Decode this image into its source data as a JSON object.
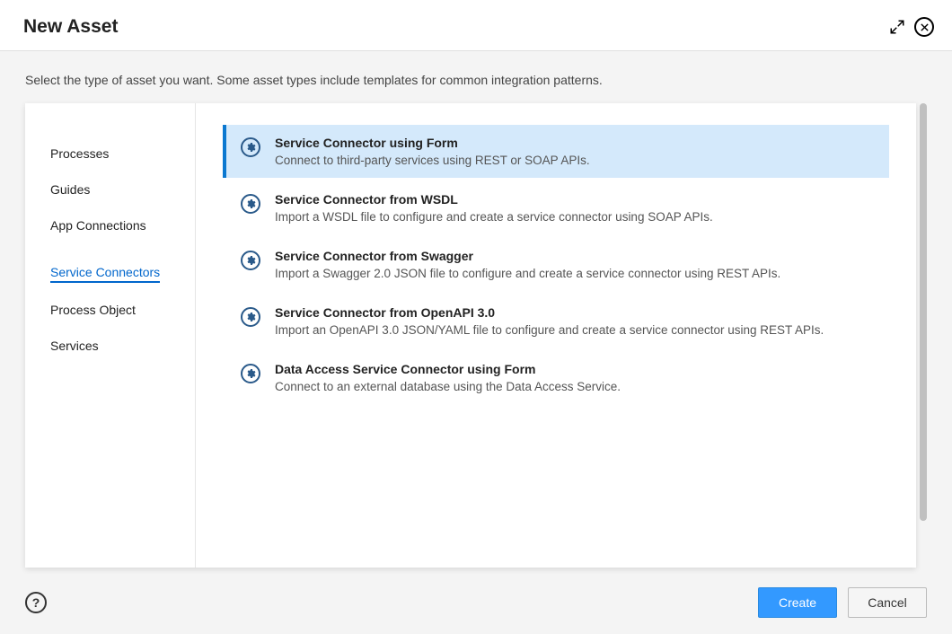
{
  "header": {
    "title": "New Asset"
  },
  "intro": "Select the type of asset you want. Some asset types include templates for common integration patterns.",
  "sidebar": {
    "items": [
      {
        "label": "Processes"
      },
      {
        "label": "Guides"
      },
      {
        "label": "App Connections"
      },
      {
        "label": "Service Connectors"
      },
      {
        "label": "Process Object"
      },
      {
        "label": "Services"
      }
    ]
  },
  "options": [
    {
      "title": "Service Connector using Form",
      "desc": "Connect to third-party services using REST or SOAP APIs."
    },
    {
      "title": "Service Connector from WSDL",
      "desc": "Import a WSDL file to configure and create a service connector using SOAP APIs."
    },
    {
      "title": "Service Connector from Swagger",
      "desc": "Import a Swagger 2.0 JSON file to configure and create a service connector using REST APIs."
    },
    {
      "title": "Service Connector from OpenAPI 3.0",
      "desc": "Import an OpenAPI 3.0 JSON/YAML file to configure and create a service connector using REST APIs."
    },
    {
      "title": "Data Access Service Connector using Form",
      "desc": "Connect to an external database using the Data Access Service."
    }
  ],
  "footer": {
    "create_label": "Create",
    "cancel_label": "Cancel"
  }
}
